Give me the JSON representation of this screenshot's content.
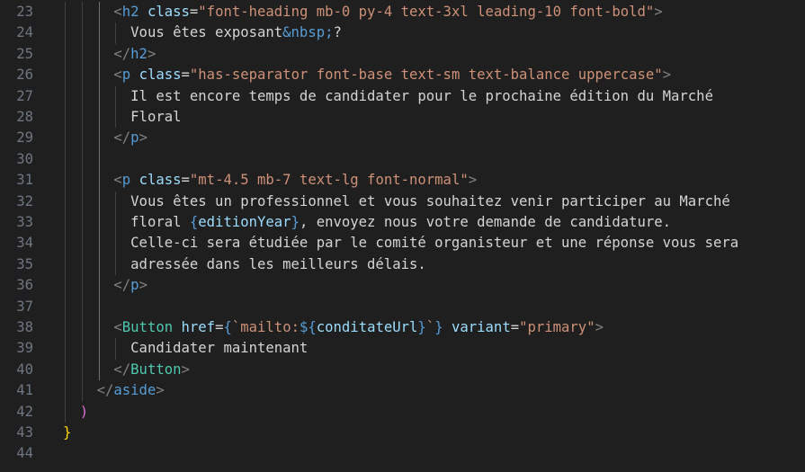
{
  "editor": {
    "lines": [
      {
        "n": "23",
        "parts": [
          [
            "tag",
            "<"
          ],
          [
            "tagname",
            "h2"
          ],
          [
            "txt",
            " "
          ],
          [
            "attr",
            "class"
          ],
          [
            "txt",
            "="
          ],
          [
            "str",
            "\"font-heading mb-0 py-4 text-3xl leading-10 font-bold\""
          ],
          [
            "tag",
            ">"
          ]
        ]
      },
      {
        "n": "24",
        "parts": [
          [
            "txt",
            "  Vous êtes exposant"
          ],
          [
            "ent",
            "&nbsp;"
          ],
          [
            "txt",
            "?"
          ]
        ]
      },
      {
        "n": "25",
        "parts": [
          [
            "tag",
            "</"
          ],
          [
            "tagname",
            "h2"
          ],
          [
            "tag",
            ">"
          ]
        ]
      },
      {
        "n": "26",
        "parts": [
          [
            "tag",
            "<"
          ],
          [
            "tagname",
            "p"
          ],
          [
            "txt",
            " "
          ],
          [
            "attr",
            "class"
          ],
          [
            "txt",
            "="
          ],
          [
            "str",
            "\"has-separator font-base text-sm text-balance uppercase\""
          ],
          [
            "tag",
            ">"
          ]
        ]
      },
      {
        "n": "27",
        "parts": [
          [
            "txt",
            "  Il est encore temps de candidater pour le prochaine édition du Marché"
          ]
        ]
      },
      {
        "n": "28",
        "parts": [
          [
            "txt",
            "  Floral"
          ]
        ]
      },
      {
        "n": "29",
        "parts": [
          [
            "tag",
            "</"
          ],
          [
            "tagname",
            "p"
          ],
          [
            "tag",
            ">"
          ]
        ]
      },
      {
        "n": "30",
        "parts": []
      },
      {
        "n": "31",
        "parts": [
          [
            "tag",
            "<"
          ],
          [
            "tagname",
            "p"
          ],
          [
            "txt",
            " "
          ],
          [
            "attr",
            "class"
          ],
          [
            "txt",
            "="
          ],
          [
            "str",
            "\"mt-4.5 mb-7 text-lg font-normal\""
          ],
          [
            "tag",
            ">"
          ]
        ]
      },
      {
        "n": "32",
        "parts": [
          [
            "txt",
            "  Vous êtes un professionnel et vous souhaitez venir participer au Marché"
          ]
        ]
      },
      {
        "n": "33",
        "parts": [
          [
            "txt",
            "  floral "
          ],
          [
            "brace",
            "{"
          ],
          [
            "var",
            "editionYear"
          ],
          [
            "brace",
            "}"
          ],
          [
            "txt",
            ", envoyez nous votre demande de candidature."
          ]
        ]
      },
      {
        "n": "34",
        "parts": [
          [
            "txt",
            "  Celle-ci sera étudiée par le comité organisteur et une réponse vous sera"
          ]
        ]
      },
      {
        "n": "35",
        "parts": [
          [
            "txt",
            "  adressée dans les meilleurs délais."
          ]
        ]
      },
      {
        "n": "36",
        "parts": [
          [
            "tag",
            "</"
          ],
          [
            "tagname",
            "p"
          ],
          [
            "tag",
            ">"
          ]
        ]
      },
      {
        "n": "37",
        "parts": []
      },
      {
        "n": "38",
        "parts": [
          [
            "tag",
            "<"
          ],
          [
            "comp",
            "Button"
          ],
          [
            "txt",
            " "
          ],
          [
            "attr",
            "href"
          ],
          [
            "txt",
            "="
          ],
          [
            "brace",
            "{"
          ],
          [
            "tpl",
            "`mailto:"
          ],
          [
            "brace",
            "${"
          ],
          [
            "var",
            "conditateUrl"
          ],
          [
            "brace",
            "}"
          ],
          [
            "tpl",
            "`"
          ],
          [
            "brace",
            "}"
          ],
          [
            "txt",
            " "
          ],
          [
            "attr",
            "variant"
          ],
          [
            "txt",
            "="
          ],
          [
            "str",
            "\"primary\""
          ],
          [
            "tag",
            ">"
          ]
        ]
      },
      {
        "n": "39",
        "parts": [
          [
            "txt",
            "  Candidater maintenant"
          ]
        ]
      },
      {
        "n": "40",
        "parts": [
          [
            "tag",
            "</"
          ],
          [
            "comp",
            "Button"
          ],
          [
            "tag",
            ">"
          ]
        ]
      },
      {
        "n": "41",
        "parts": [
          [
            "tag",
            "</"
          ],
          [
            "tagname",
            "aside"
          ],
          [
            "tag",
            ">"
          ]
        ]
      },
      {
        "n": "42",
        "parts": [
          [
            "paren-pink",
            ")"
          ]
        ]
      },
      {
        "n": "43",
        "parts": [
          [
            "brace-gold",
            "}"
          ]
        ]
      },
      {
        "n": "44",
        "parts": []
      }
    ]
  }
}
